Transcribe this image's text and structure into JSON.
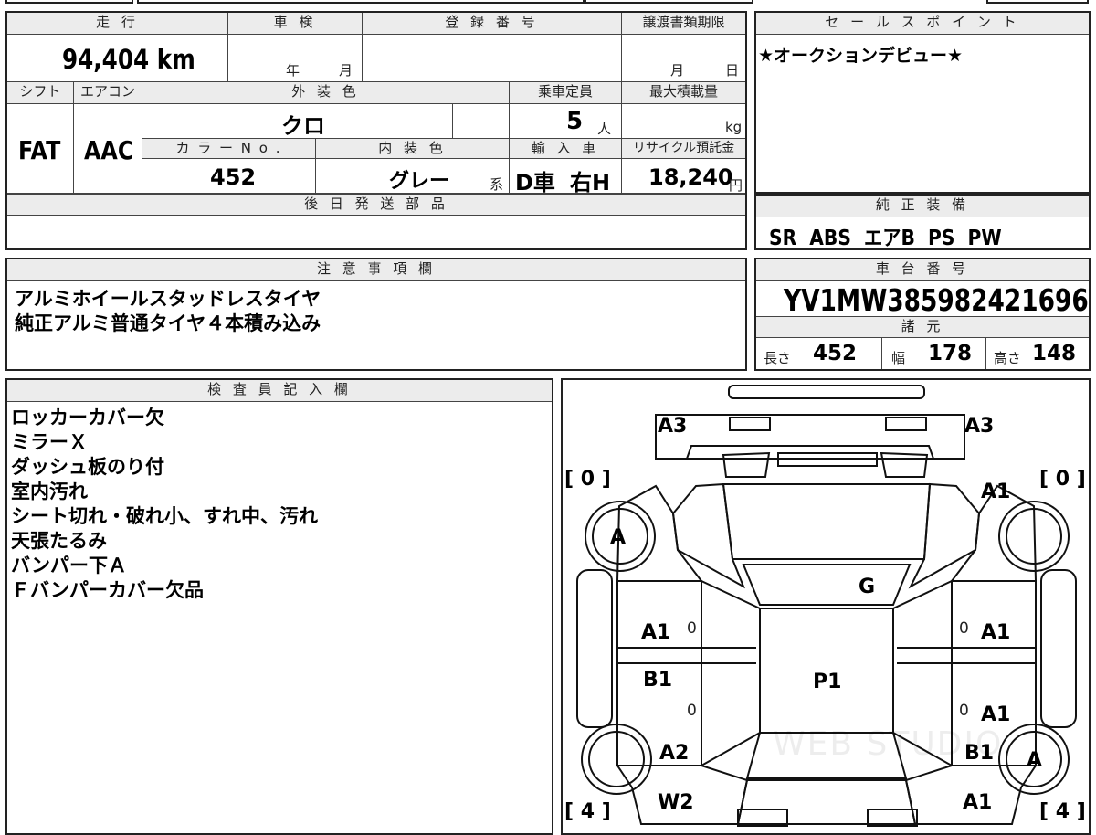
{
  "top_stubs": [
    "",
    "",
    "",
    ""
  ],
  "summary": {
    "mileage_label": "走 行",
    "mileage_value": "94,404 km",
    "inspection_label": "車 検",
    "inspection_year": "年",
    "inspection_month": "月",
    "registration_label": "登 録 番 号",
    "transfer_label": "譲渡書類期限",
    "transfer_month": "月",
    "transfer_day": "日",
    "shift_label": "シフト",
    "shift_value": "FAT",
    "aircon_label": "エアコン",
    "aircon_value": "AAC",
    "exterior_label": "外 装 色",
    "exterior_value": "クロ",
    "capacity_label": "乗車定員",
    "capacity_value": "5",
    "capacity_unit": "人",
    "maxload_label": "最大積載量",
    "maxload_unit": "kg",
    "color_no_label": "カ ラ ー N o .",
    "color_no_value": "452",
    "interior_label": "内 装 色",
    "interior_value": "グレー",
    "interior_suffix": "系",
    "import_label": "輸 入 車",
    "import_value": "D車",
    "handle_value": "右H",
    "recycle_label": "リサイクル預託金",
    "recycle_value": "18,240",
    "recycle_unit": "円",
    "later_parts_label": "後 日 発 送 部 品"
  },
  "sales_point": {
    "label": "セ ー ル ス ポ イ ン ト",
    "text": "★オークションデビュー★"
  },
  "equipment": {
    "label": "純 正 装 備",
    "text": "SR  ABS  エアB  PS  PW"
  },
  "notes": {
    "label": "注 意 事 項 欄",
    "lines": [
      "アルミホイールスタッドレスタイヤ",
      "純正アルミ普通タイヤ４本積み込み"
    ]
  },
  "chassis": {
    "label": "車 台 番 号",
    "value": "YV1MW385982421696"
  },
  "specs": {
    "label": "諸 元",
    "length_label": "長さ",
    "length_value": "452",
    "width_label": "幅",
    "width_value": "178",
    "height_label": "高さ",
    "height_value": "148"
  },
  "inspector": {
    "label": "検 査 員 記 入 欄",
    "lines": [
      "ロッカーカバー欠",
      "ミラーＸ",
      "ダッシュ板のり付",
      "室内汚れ",
      "シート切れ・破れ小、すれ中、汚れ",
      "天張たるみ",
      "バンパー下Ａ",
      "Ｆバンパーカバー欠品"
    ]
  },
  "diagram": {
    "marks": {
      "front_left": "A3",
      "front_right": "A3",
      "tread_fl": "0",
      "tread_fr": "0",
      "right_front_fender": "A1",
      "left_front_tire": "A",
      "hood": "G",
      "left_front_door": "A1",
      "left_front_door_small": "0",
      "right_front_door": "A1",
      "right_front_door_small": "0",
      "roof": "P1",
      "left_rear_door": "B1",
      "left_rear_door_small": "0",
      "right_rear_door": "A1",
      "right_rear_door_small": "0",
      "left_rear_fender": "A2",
      "right_rear_fender": "B1",
      "right_rear_tire": "A",
      "left_rear_bottom": "W2",
      "right_rear_bottom": "A1",
      "tread_rl": "4",
      "tread_rr": "4"
    },
    "watermark": "WEB STUDIO"
  }
}
